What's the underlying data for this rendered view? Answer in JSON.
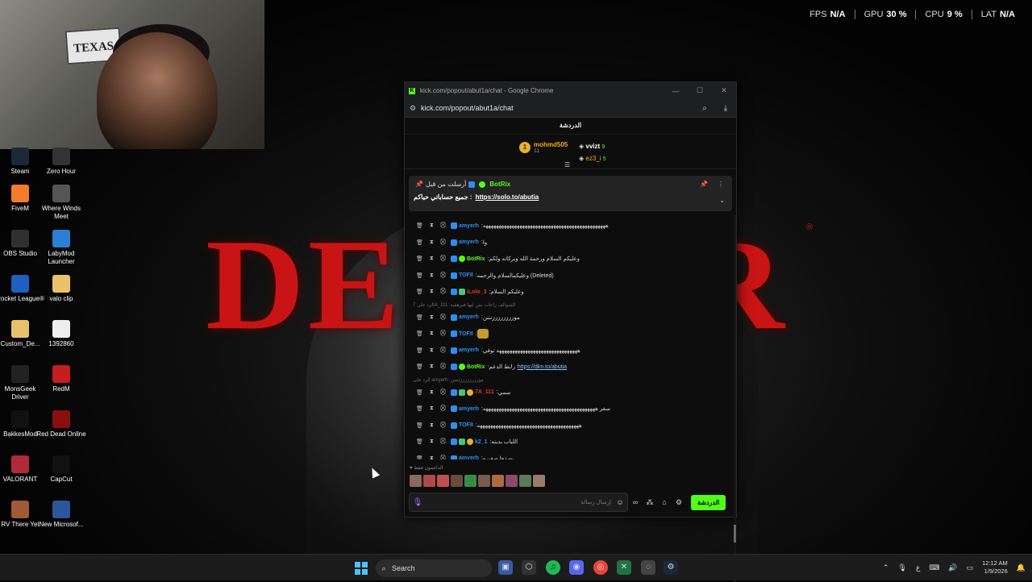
{
  "stream": {
    "title_left": "DEV",
    "title_right": "R",
    "reg": "®"
  },
  "stats": [
    {
      "label": "FPS",
      "value": "N/A"
    },
    {
      "label": "GPU",
      "value": "30 %"
    },
    {
      "label": "CPU",
      "value": "9 %"
    },
    {
      "label": "LAT",
      "value": "N/A"
    }
  ],
  "webcam": {
    "flag_text": "TEXAS"
  },
  "desktop_icons": [
    {
      "label": "Steam",
      "name": "steam",
      "icon": "steam-icon",
      "color": "#1b2838"
    },
    {
      "label": "Zero Hour",
      "name": "zero-hour",
      "icon": "zero-hour-icon",
      "color": "#333333"
    },
    {
      "label": "FiveM",
      "name": "fivem",
      "icon": "fivem-icon",
      "color": "#f57c2a"
    },
    {
      "label": "Where Winds Meet",
      "name": "where-winds-meet",
      "icon": "where-winds-meet-icon",
      "color": "#555555"
    },
    {
      "label": "OBS Studio",
      "name": "obs-studio",
      "icon": "obs-icon",
      "color": "#303030"
    },
    {
      "label": "LabyMod Launcher",
      "name": "labymod",
      "icon": "labymod-icon",
      "color": "#2a7fd4"
    },
    {
      "label": "Rocket League®",
      "name": "rocket-league",
      "icon": "rocket-league-icon",
      "color": "#1f5fbf"
    },
    {
      "label": "valo clip",
      "name": "valo-clip",
      "icon": "folder-icon",
      "color": "#e8c26a"
    },
    {
      "label": "Custom_De...",
      "name": "custom-de",
      "icon": "folder-icon",
      "color": "#e8c26a"
    },
    {
      "label": "1392860",
      "name": "file-1392860",
      "icon": "file-icon",
      "color": "#eeeeee"
    },
    {
      "label": "MonsGeek Driver",
      "name": "monsgeek-driver",
      "icon": "monsgeek-icon",
      "color": "#222222"
    },
    {
      "label": "RedM",
      "name": "redm",
      "icon": "redm-icon",
      "color": "#c41e1e"
    },
    {
      "label": "BakkesMod",
      "name": "bakkesmod",
      "icon": "bakkesmod-icon",
      "color": "#111111"
    },
    {
      "label": "Red Dead Online",
      "name": "red-dead-online",
      "icon": "red-dead-icon",
      "color": "#8a1010"
    },
    {
      "label": "VALORANT",
      "name": "valorant",
      "icon": "valorant-icon",
      "color": "#b22a3a"
    },
    {
      "label": "CapCut",
      "name": "capcut",
      "icon": "capcut-icon",
      "color": "#111111"
    },
    {
      "label": "RV There Yet",
      "name": "rv-there-yet",
      "icon": "rv-icon",
      "color": "#a05a3a"
    },
    {
      "label": "New Microsof...",
      "name": "new-microsoft-word",
      "icon": "word-icon",
      "color": "#2b579a"
    }
  ],
  "browser": {
    "title": "kick.com/popout/abut1a/chat - Google Chrome",
    "url": "kick.com/popout/abut1a/chat",
    "minimize": "—",
    "maximize": "☐",
    "close": "✕"
  },
  "chat": {
    "header": "الدردشة",
    "leaders": {
      "first": {
        "rank": "1",
        "name": "mohmd505",
        "count": "11"
      },
      "second": {
        "name": "vvizt",
        "count": "9"
      },
      "third": {
        "name": "ez3_i",
        "count": "5"
      }
    },
    "pinned": {
      "prefix": "أرسلت من قبل",
      "user": "BotRix",
      "text": "جميع حساباتي حياكم :",
      "link": "https://solo.to/abutia"
    },
    "messages": [
      {
        "user": "amyerh",
        "color": "#2d8ff2",
        "text": "هههههههههههههههههههههههههههههههههههههههههههههههه",
        "badges": [
          "blue"
        ]
      },
      {
        "user": "amyerh",
        "color": "#2d8ff2",
        "text": "وا",
        "badges": [
          "blue"
        ]
      },
      {
        "user": "BotRix",
        "color": "#53fc18",
        "text": "وعليكم السلام ورحمة الله وبركاته ولكم",
        "badges": [
          "blue",
          "green"
        ]
      },
      {
        "user": "TOFII",
        "color": "#2d8ff2",
        "text": "وعليكمالسلام والرحمه (Deleted)",
        "badges": [
          "blue"
        ]
      },
      {
        "user": "iLolo_3",
        "color": "#e0352e",
        "text": "وعليكم السلام",
        "badges": [
          "blue",
          "sub"
        ]
      },
      {
        "reply": "الرد على 7A_111: السوالف زاعات بس ليها فيرهقبه"
      },
      {
        "user": "amyerh",
        "color": "#2d8ff2",
        "text": "موززززززززنننن",
        "badges": [
          "blue"
        ]
      },
      {
        "user": "TOFII",
        "color": "#2d8ff2",
        "text": "",
        "emote": true,
        "badges": [
          "blue"
        ]
      },
      {
        "user": "amyerh",
        "color": "#2d8ff2",
        "text": "هههههههههههههههههههههههههههههههه توفي",
        "badges": [
          "blue"
        ]
      },
      {
        "user": "BotRix",
        "color": "#53fc18",
        "text": "رابط الدعم",
        "link": "https://dkn.to/abutia",
        "badges": [
          "blue",
          "green"
        ]
      },
      {
        "reply": "الرد على amyerh: موززززززززننننن"
      },
      {
        "user": "7A_111",
        "color": "#e0352e",
        "text": "سمي",
        "badges": [
          "blue",
          "sub",
          "yellow"
        ]
      },
      {
        "user": "amyerh",
        "color": "#2d8ff2",
        "text": "سفر هههههههههههههههههههههههههههههههههههههههههههه",
        "badges": [
          "blue"
        ]
      },
      {
        "user": "TOFII",
        "color": "#2d8ff2",
        "text": "هههههههههههههههههههههههههههههههههههههههه",
        "badges": [
          "blue"
        ]
      },
      {
        "user": "k2_1",
        "color": "#2d8ff2",
        "text": "اللباب بدينه",
        "badges": [
          "blue",
          "sub",
          "yellow"
        ]
      },
      {
        "user": "amyerh",
        "color": "#2d8ff2",
        "text": "يصدها صغيره",
        "badges": [
          "blue"
        ]
      }
    ],
    "supporters_label": "الداعمون فقط",
    "input_placeholder": "إرسال رسالة",
    "send_button": "الدردشة"
  },
  "taskbar": {
    "search_placeholder": "Search",
    "time": "12:12 AM",
    "date": "1/9/2026",
    "lang": "ع"
  }
}
